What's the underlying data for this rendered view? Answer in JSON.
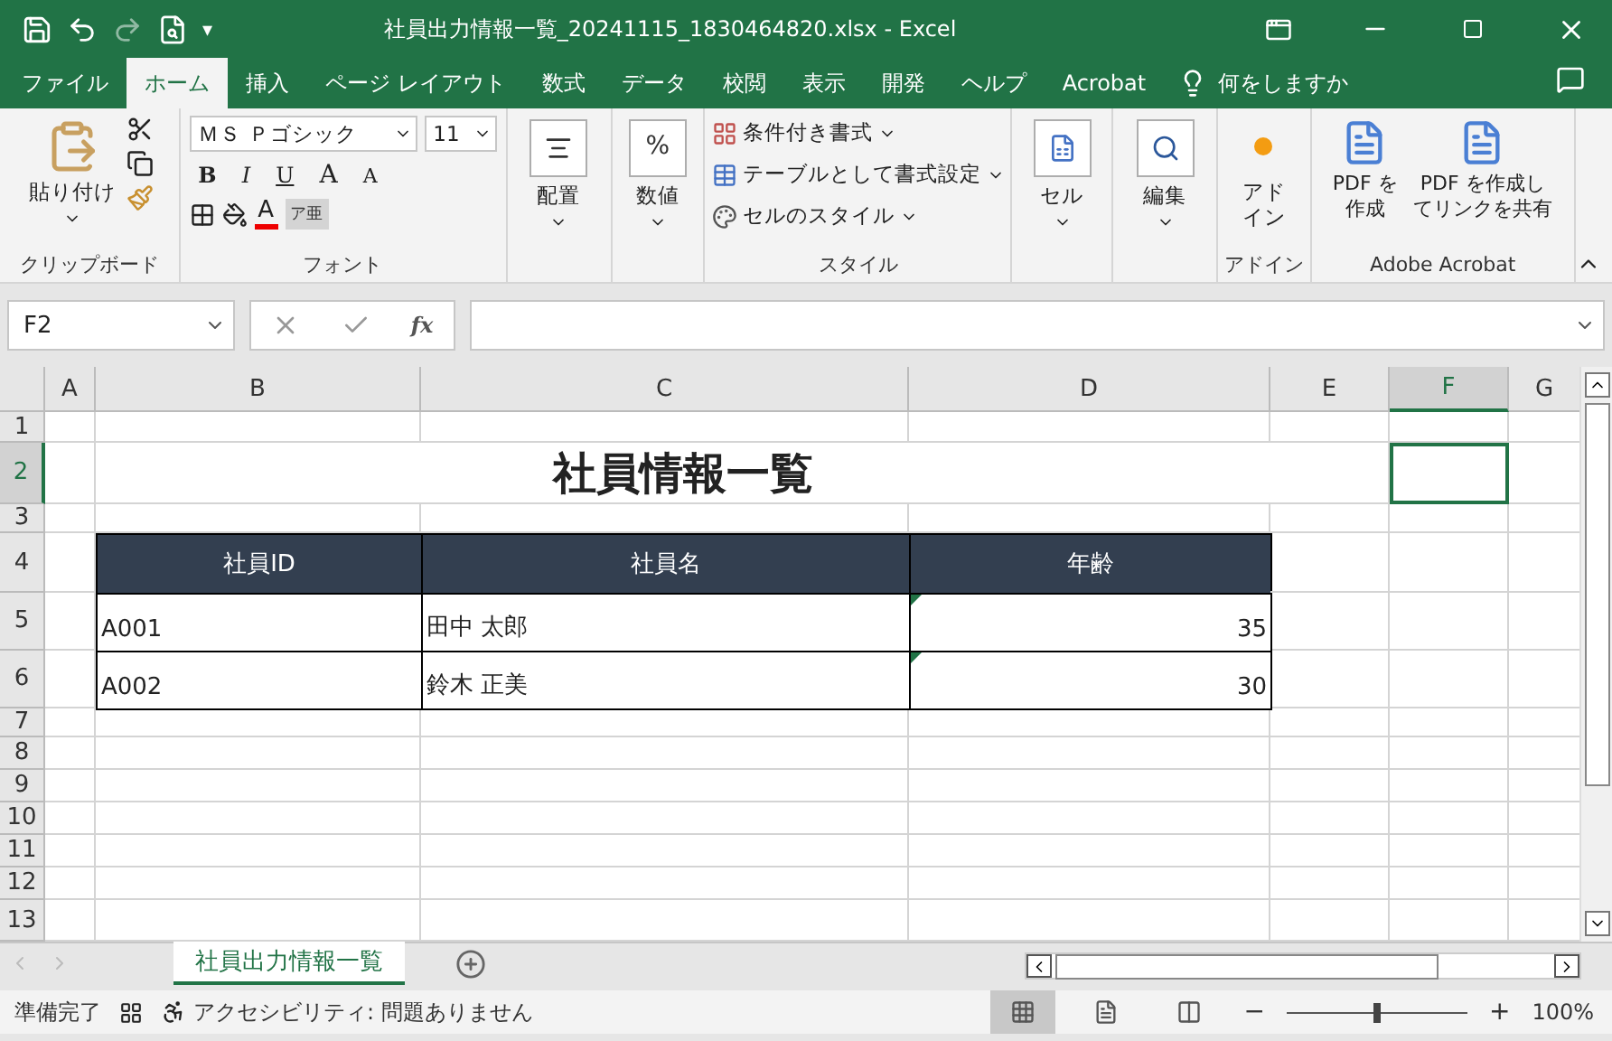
{
  "title_bar": {
    "title": "社員出力情報一覧_20241115_1830464820.xlsx  -  Excel",
    "customize_glyph": "▾"
  },
  "menu_tabs": [
    {
      "label": "ファイル",
      "selected": false
    },
    {
      "label": "ホーム",
      "selected": true
    },
    {
      "label": "挿入",
      "selected": false
    },
    {
      "label": "ページ レイアウト",
      "selected": false
    },
    {
      "label": "数式",
      "selected": false
    },
    {
      "label": "データ",
      "selected": false
    },
    {
      "label": "校閲",
      "selected": false
    },
    {
      "label": "表示",
      "selected": false
    },
    {
      "label": "開発",
      "selected": false
    },
    {
      "label": "ヘルプ",
      "selected": false
    },
    {
      "label": "Acrobat",
      "selected": false
    }
  ],
  "tell_me": "何をしますか",
  "ribbon": {
    "clipboard": {
      "paste": "貼り付け",
      "label": "クリップボード"
    },
    "font": {
      "name": "ＭＳ Ｐゴシック",
      "size": "11",
      "styles": [
        "B",
        "I",
        "U"
      ],
      "grow": "A",
      "shrink": "A",
      "color_glyph": "A",
      "phonetic_glyph": "ア亜",
      "label": "フォント"
    },
    "alignment": {
      "button": "配置"
    },
    "number": {
      "glyph": "%",
      "button": "数値"
    },
    "styles": {
      "items": [
        "条件付き書式",
        "テーブルとして書式設定",
        "セルのスタイル"
      ],
      "label": "スタイル"
    },
    "cells": {
      "button": "セル"
    },
    "editing": {
      "button": "編集"
    },
    "addins": {
      "button": "アドイン",
      "label": "アドイン"
    },
    "adobe": {
      "buttons": [
        "PDF を作成",
        "PDF を作成してリンクを共有"
      ],
      "label": "Adobe Acrobat"
    }
  },
  "formula_bar": {
    "name_box": "F2",
    "fx": "fx"
  },
  "columns": [
    {
      "label": "A",
      "selected": false
    },
    {
      "label": "B",
      "selected": false
    },
    {
      "label": "C",
      "selected": false
    },
    {
      "label": "D",
      "selected": false
    },
    {
      "label": "E",
      "selected": false
    },
    {
      "label": "F",
      "selected": true
    },
    {
      "label": "G",
      "selected": false
    }
  ],
  "rows": [
    {
      "label": "1",
      "selected": false
    },
    {
      "label": "2",
      "selected": true
    },
    {
      "label": "3",
      "selected": false
    },
    {
      "label": "4",
      "selected": false
    },
    {
      "label": "5",
      "selected": false
    },
    {
      "label": "6",
      "selected": false
    },
    {
      "label": "7",
      "selected": false
    },
    {
      "label": "8",
      "selected": false
    },
    {
      "label": "9",
      "selected": false
    },
    {
      "label": "10",
      "selected": false
    },
    {
      "label": "11",
      "selected": false
    },
    {
      "label": "12",
      "selected": false
    },
    {
      "label": "13",
      "selected": false
    }
  ],
  "sheet": {
    "title": "社員情報一覧",
    "table_headers": [
      "社員ID",
      "社員名",
      "年齢"
    ],
    "table_rows": [
      {
        "id": "A001",
        "name": "田中 太郎",
        "age": "35",
        "flagged": true
      },
      {
        "id": "A002",
        "name": "鈴木 正美",
        "age": "30",
        "flagged": true
      }
    ]
  },
  "sheet_tabs": [
    {
      "label": "社員出力情報一覧",
      "selected": true
    }
  ],
  "status_bar": {
    "ready": "準備完了",
    "accessibility": "アクセシビリティ: 問題ありません",
    "views": [
      {
        "kind": "normal",
        "selected": true
      },
      {
        "kind": "page-layout",
        "selected": false
      },
      {
        "kind": "page-break",
        "selected": false
      }
    ],
    "zoom_out": "−",
    "zoom_in": "+",
    "zoom": {
      "level": 0.5
    },
    "zoom_text": "100%"
  }
}
